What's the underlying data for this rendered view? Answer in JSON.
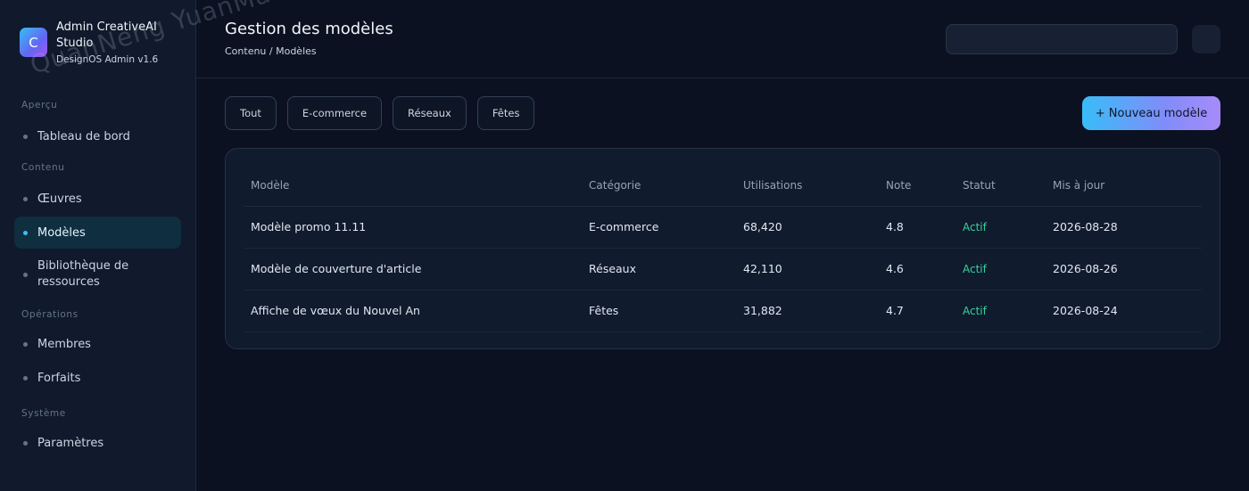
{
  "brand": {
    "logo_letter": "C",
    "title": "Admin CreativeAI Studio",
    "subtitle": "DesignOS Admin v1.6"
  },
  "sidebar": {
    "sections": [
      {
        "label": "Aperçu",
        "items": [
          {
            "label": "Tableau de bord"
          }
        ]
      },
      {
        "label": "Contenu",
        "items": [
          {
            "label": "Œuvres"
          },
          {
            "label": "Modèles",
            "active": true
          },
          {
            "label": "Bibliothèque de ressources"
          }
        ]
      },
      {
        "label": "Opérations",
        "items": [
          {
            "label": "Membres"
          },
          {
            "label": "Forfaits"
          }
        ]
      },
      {
        "label": "Système",
        "items": [
          {
            "label": "Paramètres"
          }
        ]
      }
    ]
  },
  "header": {
    "title": "Gestion des modèles",
    "breadcrumb": "Contenu / Modèles",
    "search_placeholder": ""
  },
  "filters": [
    "Tout",
    "E-commerce",
    "Réseaux",
    "Fêtes"
  ],
  "new_button": "+ Nouveau modèle",
  "table": {
    "columns": [
      "Modèle",
      "Catégorie",
      "Utilisations",
      "Note",
      "Statut",
      "Mis à jour"
    ],
    "rows": [
      [
        "Modèle promo 11.11",
        "E-commerce",
        "68,420",
        "4.8",
        "Actif",
        "2026-08-28"
      ],
      [
        "Modèle de couverture d'article",
        "Réseaux",
        "42,110",
        "4.6",
        "Actif",
        "2026-08-26"
      ],
      [
        "Affiche de vœux du Nouvel An",
        "Fêtes",
        "31,882",
        "4.7",
        "Actif",
        "2026-08-24"
      ]
    ]
  },
  "watermark": "QuanNeng YuanMa · inzyxuashop.com",
  "colors": {
    "accent": "#38bdf8",
    "status_active": "#34d399",
    "background": "#0b1120"
  }
}
